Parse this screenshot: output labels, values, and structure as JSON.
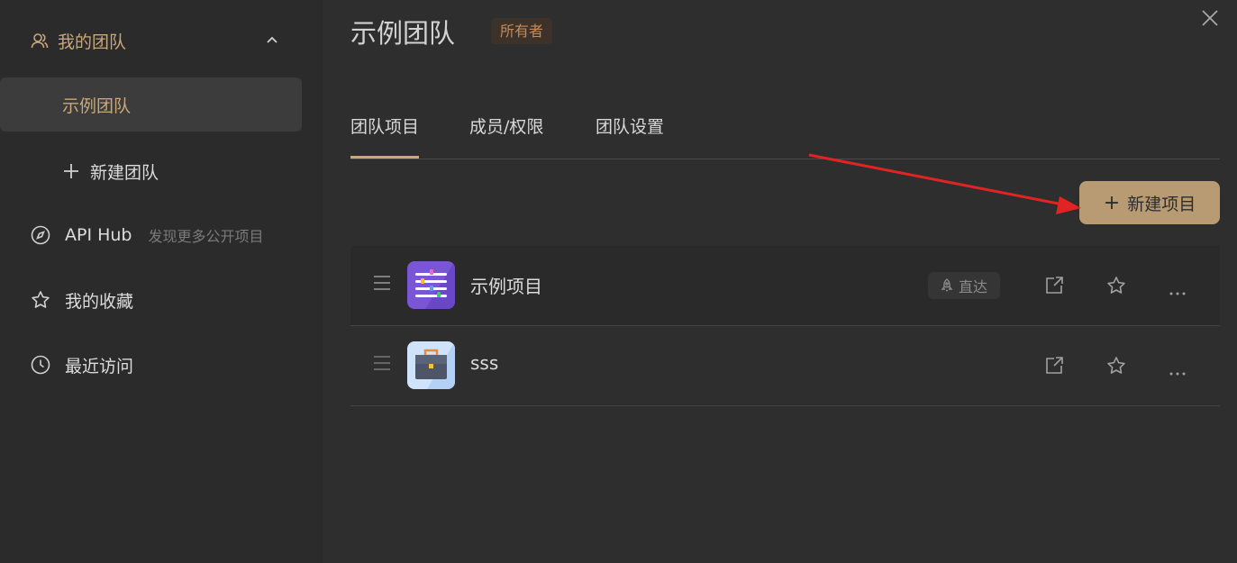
{
  "sidebar": {
    "team_header": "我的团队",
    "selected_team": "示例团队",
    "new_team": "新建团队",
    "api_hub": {
      "label": "API Hub",
      "desc": "发现更多公开项目"
    },
    "favorites": "我的收藏",
    "recent": "最近访问"
  },
  "main": {
    "title": "示例团队",
    "owner_badge": "所有者",
    "tabs": [
      {
        "label": "团队项目",
        "active": true
      },
      {
        "label": "成员/权限",
        "active": false
      },
      {
        "label": "团队设置",
        "active": false
      }
    ],
    "new_project_button": "新建项目",
    "projects": [
      {
        "name": "示例项目",
        "badge": "直达"
      },
      {
        "name": "sss"
      }
    ]
  },
  "colors": {
    "accent": "#c9a778",
    "button_bg": "#b89b72",
    "arrow": "#e02424"
  }
}
